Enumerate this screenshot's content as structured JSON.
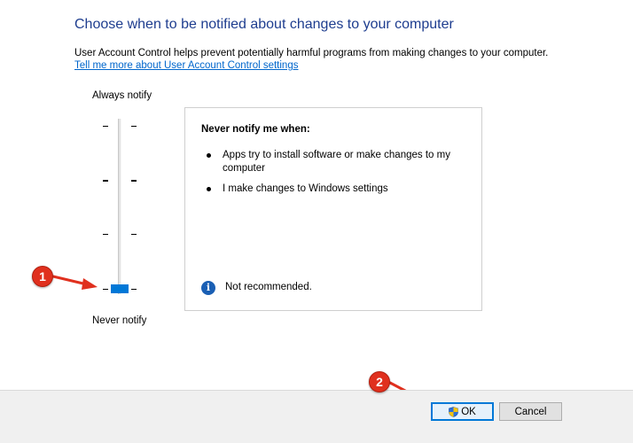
{
  "header": {
    "title": "Choose when to be notified about changes to your computer",
    "description": "User Account Control helps prevent potentially harmful programs from making changes to your computer.",
    "link_text": "Tell me more about User Account Control settings"
  },
  "slider": {
    "top_label": "Always notify",
    "bottom_label": "Never notify",
    "levels": 4,
    "selected_level": 1
  },
  "info_panel": {
    "heading": "Never notify me when:",
    "bullets": [
      "Apps try to install software or make changes to my computer",
      "I make changes to Windows settings"
    ],
    "recommendation": "Not recommended."
  },
  "buttons": {
    "ok_label": "OK",
    "cancel_label": "Cancel"
  },
  "annotations": {
    "marker_1": "1",
    "marker_2": "2"
  },
  "icons": {
    "info": "info-icon",
    "ok_shield": "uac-shield-icon"
  },
  "colors": {
    "title": "#1e3d8f",
    "link": "#0066cc",
    "slider_thumb": "#0078d7",
    "info_icon": "#1a5fb4",
    "marker": "#e0301e"
  }
}
